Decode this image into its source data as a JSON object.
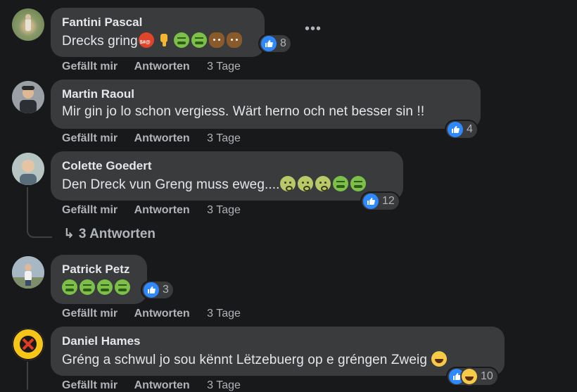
{
  "comments": [
    {
      "author": "Fantini Pascal",
      "text": "Drecks gring",
      "emojis": [
        "pouting-cursing-emoji",
        "thumbs-down-emoji",
        "nauseated-emoji",
        "nauseated-emoji",
        "poop-emoji",
        "poop-emoji"
      ],
      "likes": "8",
      "like_label": "Gefällt mir",
      "reply_label": "Antworten",
      "time": "3 Tage"
    },
    {
      "author": "Martin Raoul",
      "text": "Mir gin jo lo schon vergiess. Wärt herno och net besser sin !!",
      "emojis": [],
      "likes": "4",
      "like_label": "Gefällt mir",
      "reply_label": "Antworten",
      "time": "3 Tage"
    },
    {
      "author": "Colette Goedert",
      "text": "Den Dreck vun Greng muss eweg....",
      "emojis": [
        "woozy-emoji",
        "woozy-emoji",
        "woozy-emoji",
        "nauseated-emoji",
        "nauseated-emoji"
      ],
      "likes": "12",
      "like_label": "Gefällt mir",
      "reply_label": "Antworten",
      "time": "3 Tage",
      "replies_label": "3 Antworten"
    },
    {
      "author": "Patrick Petz",
      "text": "",
      "emojis": [
        "nauseated-emoji",
        "nauseated-emoji",
        "nauseated-emoji",
        "nauseated-emoji"
      ],
      "likes": "3",
      "like_label": "Gefällt mir",
      "reply_label": "Antworten",
      "time": "3 Tage"
    },
    {
      "author": "Daniel Hames",
      "text": "Gréng a schwul jo sou kënnt Lëtzebuerg op e gréngen Zweig",
      "emojis": [
        "laughing-emoji"
      ],
      "likes": "10",
      "like_label": "Gefällt mir",
      "reply_label": "Antworten",
      "time": "3 Tage"
    }
  ],
  "colors": {
    "background": "#18191a",
    "bubble": "#3a3b3c",
    "like": "#2e89ff",
    "muted": "#b0b3b8"
  }
}
